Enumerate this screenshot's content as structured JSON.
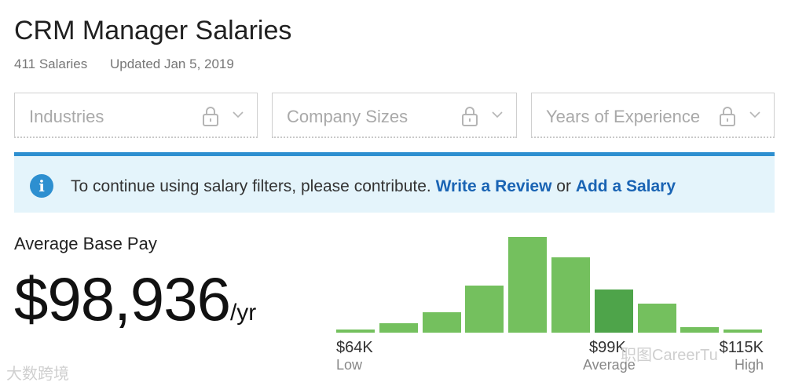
{
  "header": {
    "title": "CRM Manager Salaries",
    "count": "411 Salaries",
    "updated": "Updated Jan 5, 2019"
  },
  "filters": [
    {
      "label": "Industries"
    },
    {
      "label": "Company Sizes"
    },
    {
      "label": "Years of Experience"
    }
  ],
  "notice": {
    "text": "To continue using salary filters, please contribute.",
    "link1": "Write a Review",
    "or": "or",
    "link2": "Add a Salary"
  },
  "pay": {
    "label": "Average Base Pay",
    "amount": "$98,936",
    "unit": "/yr"
  },
  "chart_data": {
    "type": "bar",
    "values": [
      3,
      9,
      20,
      46,
      93,
      73,
      42,
      28,
      5,
      3
    ],
    "highlight_index": 6,
    "axis_labels": {
      "low_value": "$64K",
      "low_label": "Low",
      "avg_value": "$99K",
      "avg_label": "Average",
      "high_value": "$115K",
      "high_label": "High"
    }
  },
  "colors": {
    "bar": "#74c05e",
    "bar_highlight": "#4ea44a",
    "link": "#1a64b4",
    "accent": "#2d8fd0"
  },
  "watermarks": {
    "left": "大数跨境",
    "right": "职图CareerTu"
  }
}
